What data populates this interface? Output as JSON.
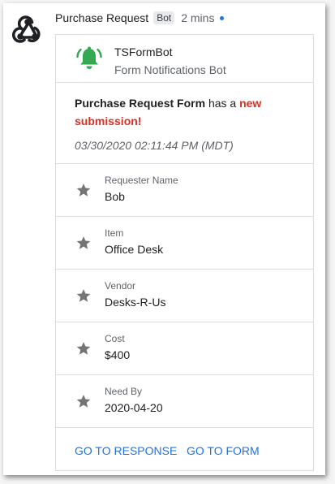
{
  "message": {
    "sender": "Purchase Request",
    "badge": "Bot",
    "time": "2 mins"
  },
  "card": {
    "bot_name": "TSFormBot",
    "bot_subtitle": "Form Notifications Bot",
    "body": {
      "form_name": "Purchase Request Form",
      "middle_text": " has a ",
      "highlight": "new submission!",
      "date": "03/30/2020  02:11:44 PM (MDT)"
    },
    "fields": [
      {
        "label": "Requester Name",
        "value": "Bob"
      },
      {
        "label": "Item",
        "value": "Office Desk"
      },
      {
        "label": "Vendor",
        "value": "Desks-R-Us"
      },
      {
        "label": "Cost",
        "value": "$400"
      },
      {
        "label": "Need By",
        "value": "2020-04-20"
      }
    ],
    "actions": {
      "response": "GO TO RESPONSE",
      "form": "GO TO FORM"
    }
  },
  "icons": {
    "app": "webhooks-icon",
    "bot": "bell-icon",
    "field": "star-icon"
  },
  "colors": {
    "accent": "#1a73e8",
    "highlight": "#d93025",
    "bell": "#34a853"
  }
}
